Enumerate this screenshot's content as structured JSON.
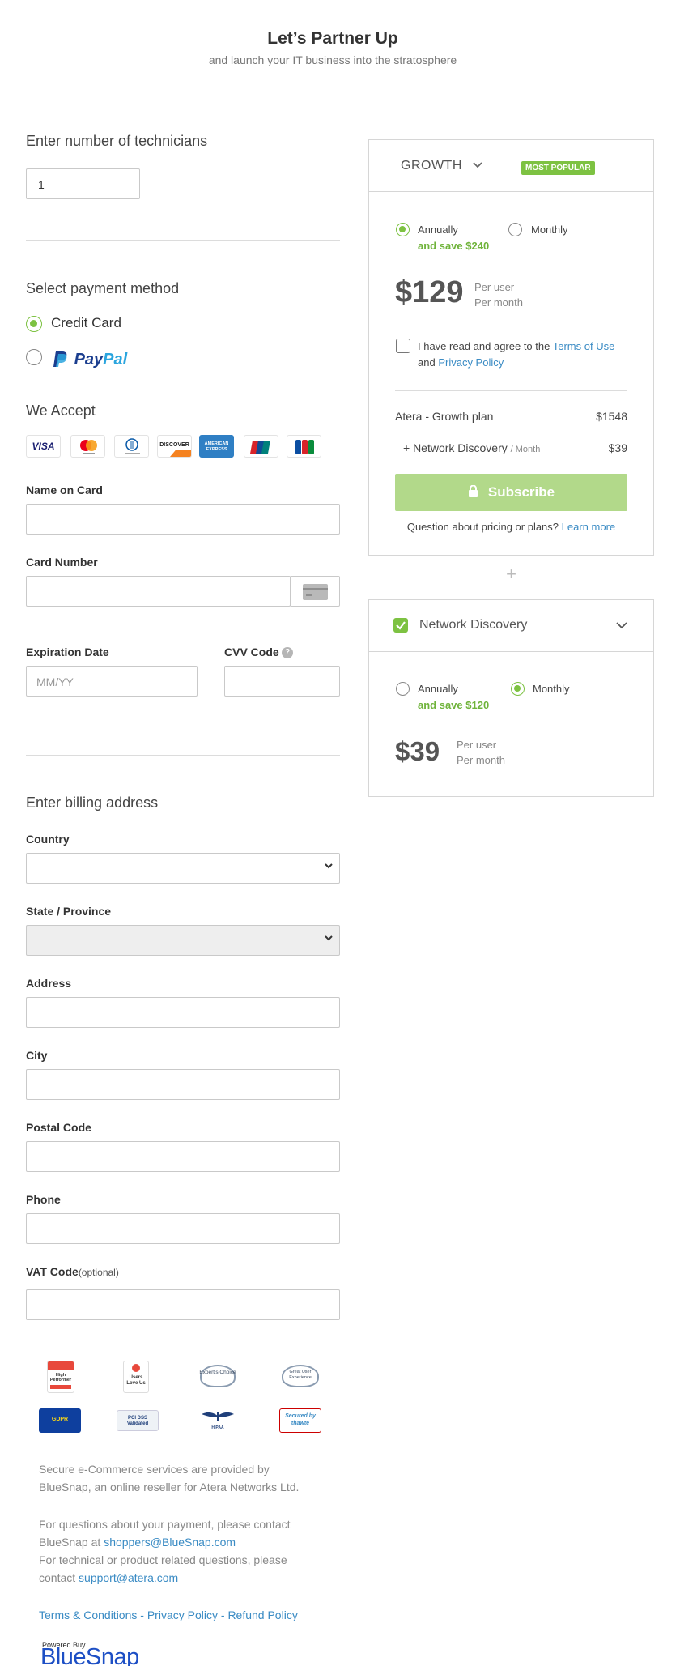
{
  "header": {
    "title": "Let’s Partner Up",
    "subtitle": "and launch your IT business into the stratosphere"
  },
  "technicians": {
    "heading": "Enter number of technicians",
    "value": "1"
  },
  "payment": {
    "heading": "Select payment method",
    "options": [
      {
        "label": "Credit Card",
        "selected": true
      },
      {
        "label": "PayPal",
        "selected": false
      }
    ],
    "we_accept": "We Accept",
    "cards": [
      {
        "name": "VISA"
      },
      {
        "name": "MasterCard"
      },
      {
        "name": "Diners Club"
      },
      {
        "name": "DISCOVER"
      },
      {
        "name": "AMERICAN EXPRESS"
      },
      {
        "name": "UnionPay"
      },
      {
        "name": "JCB"
      }
    ]
  },
  "card_form": {
    "name_label": "Name on Card",
    "number_label": "Card Number",
    "expiry_label": "Expiration Date",
    "expiry_placeholder": "MM/YY",
    "cvv_label": "CVV Code"
  },
  "billing": {
    "heading": "Enter billing address",
    "country_label": "Country",
    "state_label": "State / Province",
    "address_label": "Address",
    "city_label": "City",
    "postal_label": "Postal Code",
    "phone_label": "Phone",
    "vat_label": "VAT Code",
    "vat_optional": "(optional)"
  },
  "plan": {
    "name": "GROWTH",
    "badge": "MOST POPULAR",
    "annually": "Annually",
    "annual_save": "and save $240",
    "monthly": "Monthly",
    "selected_period": "Annually",
    "price": "$129",
    "per_user": "Per user",
    "per_month": "Per month",
    "agree_prefix": "I have read and agree to the",
    "terms_link": "Terms of Use",
    "agree_and": "and",
    "privacy_link": "Privacy Policy",
    "line1_label": "Atera - Growth plan",
    "line1_value": "$1548",
    "line2_label": "+ Network Discovery",
    "line2_unit": "/ Month",
    "line2_value": "$39",
    "subscribe": "Subscribe",
    "question": "Question about pricing or plans?",
    "learn_more": "Learn more"
  },
  "plus": "+",
  "addon": {
    "name": "Network Discovery",
    "checked": true,
    "annually": "Annually",
    "annual_save": "and save $120",
    "monthly": "Monthly",
    "selected_period": "Monthly",
    "price": "$39",
    "per_user": "Per user",
    "per_month": "Per month"
  },
  "badges": [
    {
      "name": "High Performer",
      "sub": "SUMMER 2020"
    },
    {
      "name": "Users Love Us",
      "sub": "G2"
    },
    {
      "name": "Expert's Choice",
      "sub": "2019 Award"
    },
    {
      "name": "Great User Experience",
      "sub": "2019 Award"
    },
    {
      "name": "GDPR",
      "sub": ""
    },
    {
      "name": "PCI DSS Validated",
      "sub": ""
    },
    {
      "name": "HIPAA",
      "sub": "COMPLIANCE"
    },
    {
      "name": "Secured by thawte",
      "sub": ""
    }
  ],
  "footer": {
    "para1": "Secure e-Commerce services are provided by BlueSnap, an online reseller for Atera Networks Ltd.",
    "para2_prefix": "For questions about your payment, please contact BlueSnap at",
    "para2_email": "shoppers@BlueSnap.com",
    "para3_prefix": "For technical or product related questions, please contact",
    "para3_email": "support@atera.com",
    "links": [
      "Terms & Conditions",
      "Privacy Policy",
      "Refund Policy"
    ],
    "link_sep": " - ",
    "powered": "Powered Buy",
    "brand": "BlueSnap"
  },
  "colors": {
    "accent": "#7dc242",
    "accent_light": "#b2d98a",
    "link": "#3a8bc4"
  }
}
